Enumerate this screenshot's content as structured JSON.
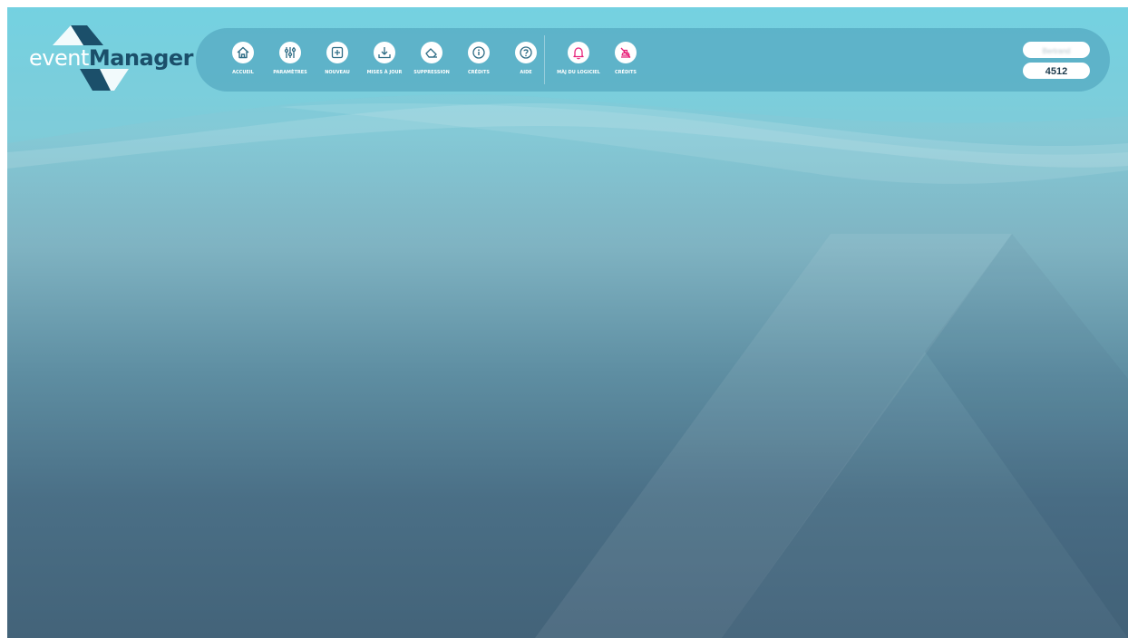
{
  "app": {
    "logo_part1": "event",
    "logo_part2": "Manager"
  },
  "toolbar": {
    "items": [
      {
        "label": "ACCUEIL",
        "icon": "home-icon"
      },
      {
        "label": "PARAMÈTRES",
        "icon": "sliders-icon"
      },
      {
        "label": "NOUVEAU",
        "icon": "plus-square-icon"
      },
      {
        "label": "MISES À JOUR",
        "icon": "download-tray-icon"
      },
      {
        "label": "SUPPRESSION",
        "icon": "eraser-icon"
      },
      {
        "label": "CRÉDITS",
        "icon": "info-icon"
      },
      {
        "label": "AIDE",
        "icon": "help-icon"
      }
    ],
    "alerts": [
      {
        "label": "MÀJ DU LOGICIEL",
        "icon": "bell-icon",
        "color": "#e8227a"
      },
      {
        "label": "CRÉDITS",
        "icon": "credits-off-icon",
        "color": "#e8227a"
      }
    ]
  },
  "user": {
    "name": "Bertrand",
    "counter": "4512"
  },
  "colors": {
    "accent": "#e8227a",
    "brand_dark": "#1b4f6a",
    "toolbar_icon": "#2f6d86"
  }
}
